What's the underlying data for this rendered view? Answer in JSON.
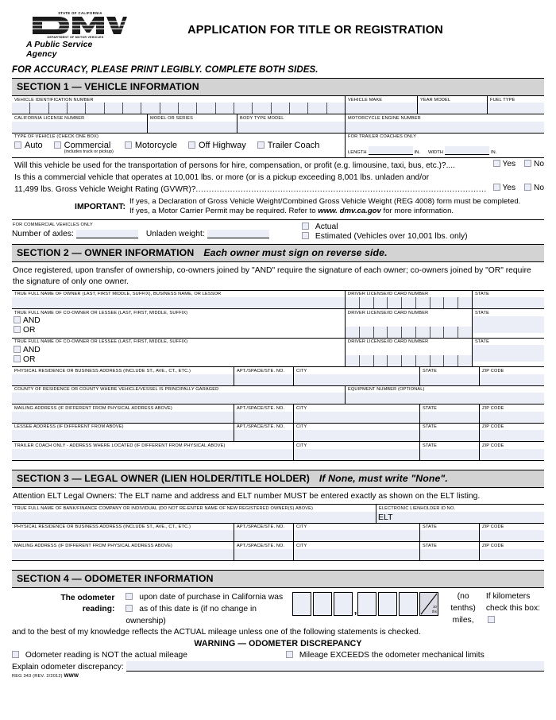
{
  "header": {
    "state_line": "STATE OF CALIFORNIA",
    "dept_line": "DEPARTMENT OF MOTOR VEHICLES",
    "tagline": "A Public Service Agency",
    "logo_text": "DMV",
    "title": "APPLICATION FOR TITLE OR REGISTRATION",
    "accuracy_note": "FOR ACCURACY, PLEASE PRINT LEGIBLY. COMPLETE BOTH SIDES."
  },
  "section1": {
    "bar": "SECTION 1 — VEHICLE INFORMATION",
    "vin_label": "VEHICLE IDENTIFICATION NUMBER",
    "vin_boxes": 18,
    "vehicle_make": "VEHICLE MAKE",
    "year_model": "YEAR MODEL",
    "fuel_type": "FUEL TYPE",
    "ca_license": "CALIFORNIA LICENSE NUMBER",
    "model_or_series": "MODEL OR SERIES",
    "body_type_model": "BODY TYPE MODEL",
    "motorcycle_engine": "MOTORCYCLE ENGINE NUMBER",
    "type_of_vehicle_label": "TYPE OF VEHICLE (CHECK ONE BOX)",
    "types": [
      {
        "label": "Auto",
        "sub": ""
      },
      {
        "label": "Commercial",
        "sub": "(includes truck or pickup)"
      },
      {
        "label": "Motorcycle",
        "sub": ""
      },
      {
        "label": "Off Highway",
        "sub": ""
      },
      {
        "label": "Trailer Coach",
        "sub": ""
      }
    ],
    "trailer_only_label": "FOR TRAILER COACHES ONLY",
    "trailer_length": "LENGTH",
    "trailer_width": "WIDTH",
    "trailer_unit": "IN.",
    "q1": "Will this vehicle be used for the transportation of persons for hire, compensation, or profit (e.g. limousine, taxi, bus, etc.)?....",
    "q2_line1": "Is this a commercial vehicle that operates at 10,001 lbs. or more (or is a pickup exceeding 8,001 lbs. unladen and/or",
    "q2_line2": "11,499 lbs. Gross Vehicle Weight Rating (GVWR)?",
    "q2_dots": "................................................................................................................................",
    "yes": "Yes",
    "no": "No",
    "important_word": "IMPORTANT:",
    "important_line1": "If yes, a Declaration of Gross Vehicle Weight/Combined Gross Vehicle Weight (REG 4008) form must be completed.",
    "important_line2_a": "If yes, a Motor Carrier Permit may be required. Refer to ",
    "important_line2_url": "www. dmv.ca.gov",
    "important_line2_b": " for more information.",
    "commercial_only_label": "FOR COMMERCIAL VEHICLES ONLY",
    "axles_label": "Number of axles:",
    "unladen_label": "Unladen weight:",
    "actual": "Actual",
    "estimated": "Estimated (Vehicles over 10,001 lbs. only)"
  },
  "section2": {
    "bar": "SECTION 2 — OWNER INFORMATION",
    "bar_sub": "Each owner must sign on reverse side.",
    "intro_line1": "Once registered, upon transfer of ownership, co-owners joined by \"AND\" require the signature of each owner; co-owners joined by \"OR\" require",
    "intro_line2": "the signature of only one owner.",
    "owner_name_label": "TRUE FULL NAME OF OWNER (LAST, FIRST MIDDLE, SUFFIX), BUSINESS NAME, OR LESSOR",
    "coowner_name_label": "TRUE FULL NAME OF CO-OWNER OR LESSEE (LAST, FIRST, MIDDLE, SUFFIX)",
    "dl_label": "DRIVER LICENSE/ID CARD NUMBER",
    "dl_boxes": 9,
    "state_label": "STATE",
    "and_label": "AND",
    "or_label": "OR",
    "physical_address_label": "PHYSICAL RESIDENCE OR BUSINESS ADDRESS (INCLUDE ST., AVE., CT., ETC.)",
    "apt_label": "APT./SPACE/STE. NO.",
    "city_label": "CITY",
    "zip_label": "ZIP CODE",
    "county_label": "COUNTY OF RESIDENCE OR COUNTY WHERE VEHICLE/VESSEL IS PRINCIPALLY GARAGED",
    "equipment_label": "EQUIPMENT NUMBER (OPTIONAL)",
    "mailing_label": "MAILING ADDRESS (IF DIFFERENT FROM PHYSICAL ADDRESS ABOVE)",
    "lessee_label": "LESSEE ADDRESS (IF DIFFERENT FROM ABOVE)",
    "trailer_addr_label": "TRAILER COACH ONLY - ADDRESS WHERE LOCATED (IF DIFFERENT FROM PHYSICAL ABOVE)"
  },
  "section3": {
    "bar": "SECTION 3 — LEGAL OWNER (LIEN HOLDER/TITLE HOLDER)",
    "bar_sub": "If None, must write \"None\".",
    "attention": "Attention ELT Legal Owners: The ELT name and address and ELT number MUST be entered exactly as shown on the ELT listing.",
    "bank_label": "TRUE FULL NAME OF BANK/FINANCE COMPANY OR INDIVIDUAL (DO NOT RE-ENTER NAME OF NEW REGISTERED OWNER(S) ABOVE)",
    "elt_label": "ELECTRONIC LIENHOLDER ID NO.",
    "elt_value": "ELT",
    "physical_address_label": "PHYSICAL RESIDENCE OR BUSINESS ADDRESS (INCLUDE ST., AVE., CT., ETC.)",
    "apt_label": "APT./SPACE/STE. NO.",
    "city_label": "CITY",
    "state_label": "STATE",
    "zip_label": "ZIP CODE",
    "mailing_label": "MAILING ADDRESS (IF DIFFERENT FROM PHYSICAL ADDRESS ABOVE)"
  },
  "section4": {
    "bar": "SECTION 4 — ODOMETER INFORMATION",
    "reading_label_l1": "The odometer",
    "reading_label_l2": "reading:",
    "opt1": "upon date of purchase in California was",
    "opt2": "as of this date is (if no change in ownership)",
    "boxes": 6,
    "comma": ",",
    "tenths_top": "10",
    "tenths_bottom": "ths",
    "no_tenths": "(no tenths)",
    "miles": "miles,",
    "if_km_l1": "If kilometers",
    "if_km_l2": "check this box:",
    "actual_statement": "and to the best of my knowledge reflects the ACTUAL mileage unless one of the following statements is checked.",
    "warning": "WARNING — ODOMETER DISCREPANCY",
    "warn1": "Odometer reading is NOT the actual mileage",
    "warn2": "Mileage EXCEEDS the odometer mechanical limits",
    "explain_label": "Explain odometer discrepancy:",
    "footer_a": "REG 343 (REV. 2/2012) ",
    "footer_b": "WWW"
  },
  "colors": {
    "field_fill": "#eceef7",
    "section_bar": "#d3d3d3",
    "border": "#000000"
  }
}
